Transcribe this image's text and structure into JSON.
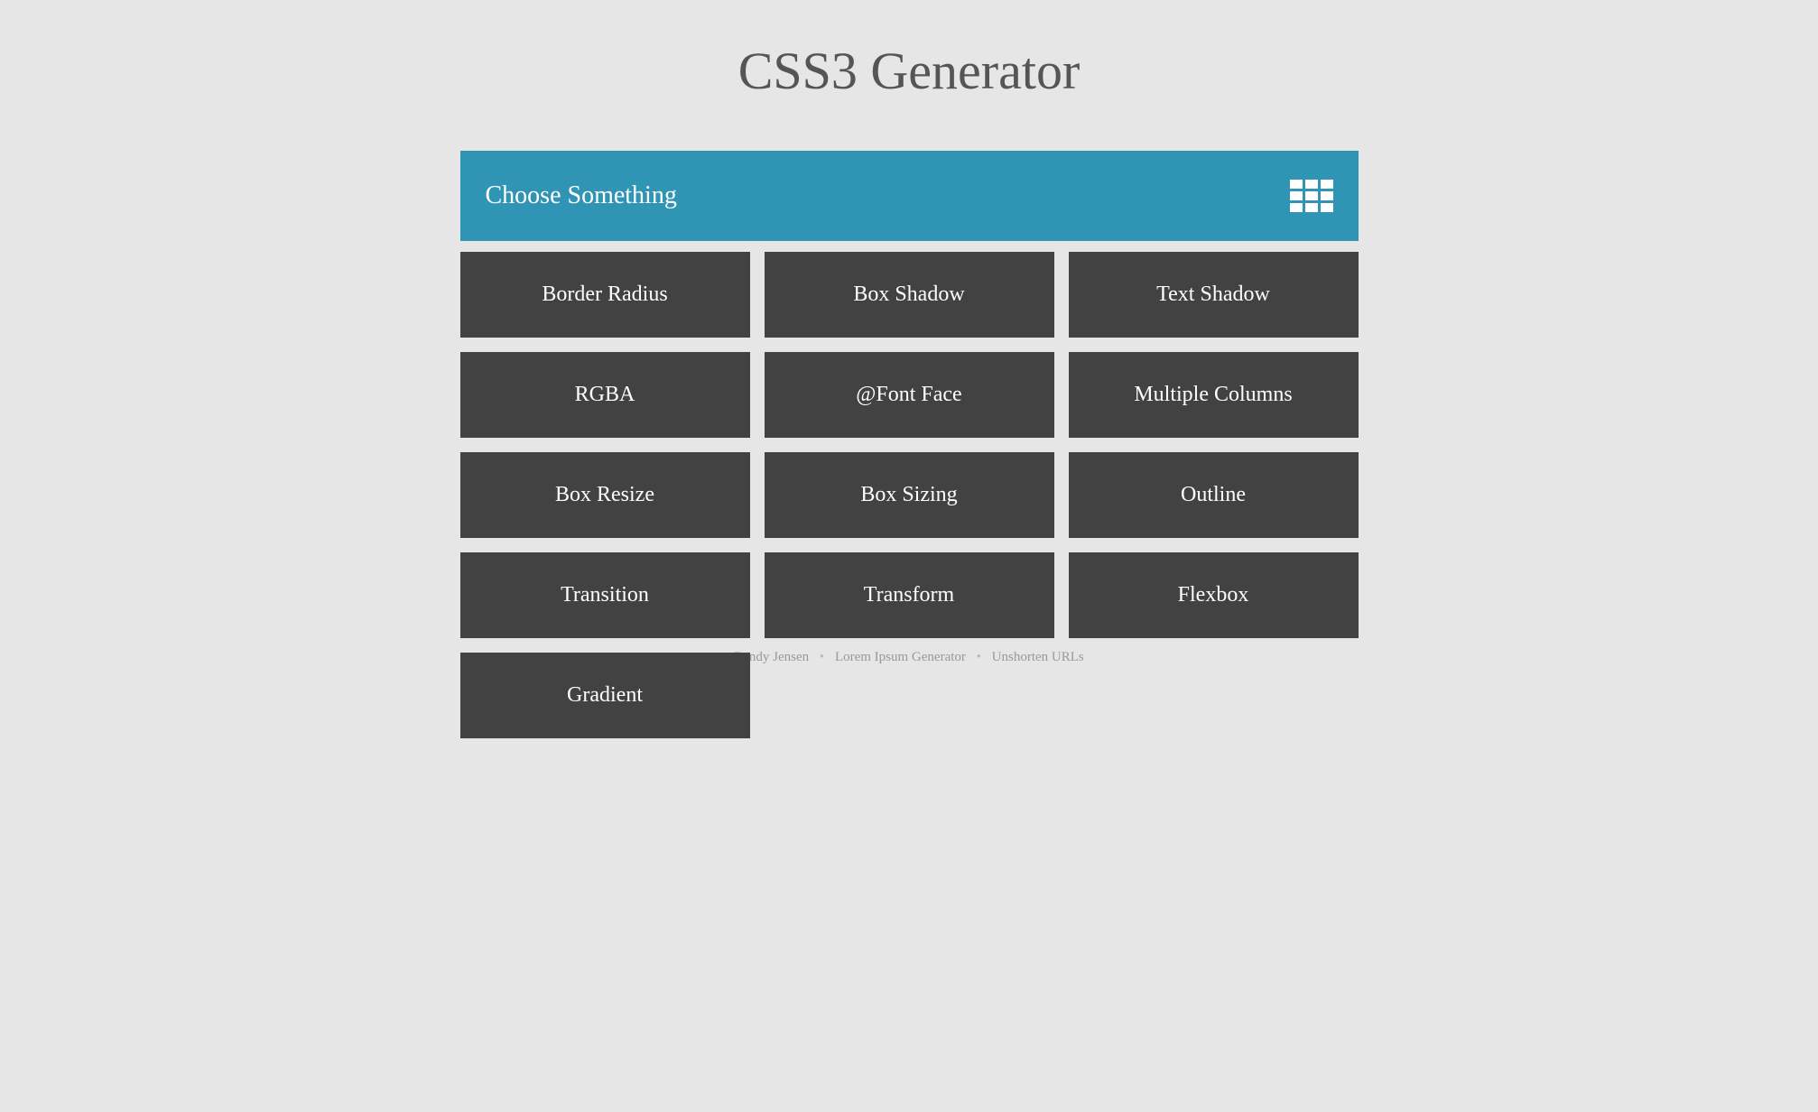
{
  "header": {
    "title": "CSS3 Generator"
  },
  "selector": {
    "label": "Choose Something"
  },
  "options": [
    {
      "label": "Border Radius"
    },
    {
      "label": "Box Shadow"
    },
    {
      "label": "Text Shadow"
    },
    {
      "label": "RGBA"
    },
    {
      "label": "@Font Face"
    },
    {
      "label": "Multiple Columns"
    },
    {
      "label": "Box Resize"
    },
    {
      "label": "Box Sizing"
    },
    {
      "label": "Outline"
    },
    {
      "label": "Transition"
    },
    {
      "label": "Transform"
    },
    {
      "label": "Flexbox"
    },
    {
      "label": "Gradient"
    }
  ],
  "footer": {
    "links": [
      "Randy Jensen",
      "Lorem Ipsum Generator",
      "Unshorten URLs"
    ],
    "separator": "•"
  }
}
